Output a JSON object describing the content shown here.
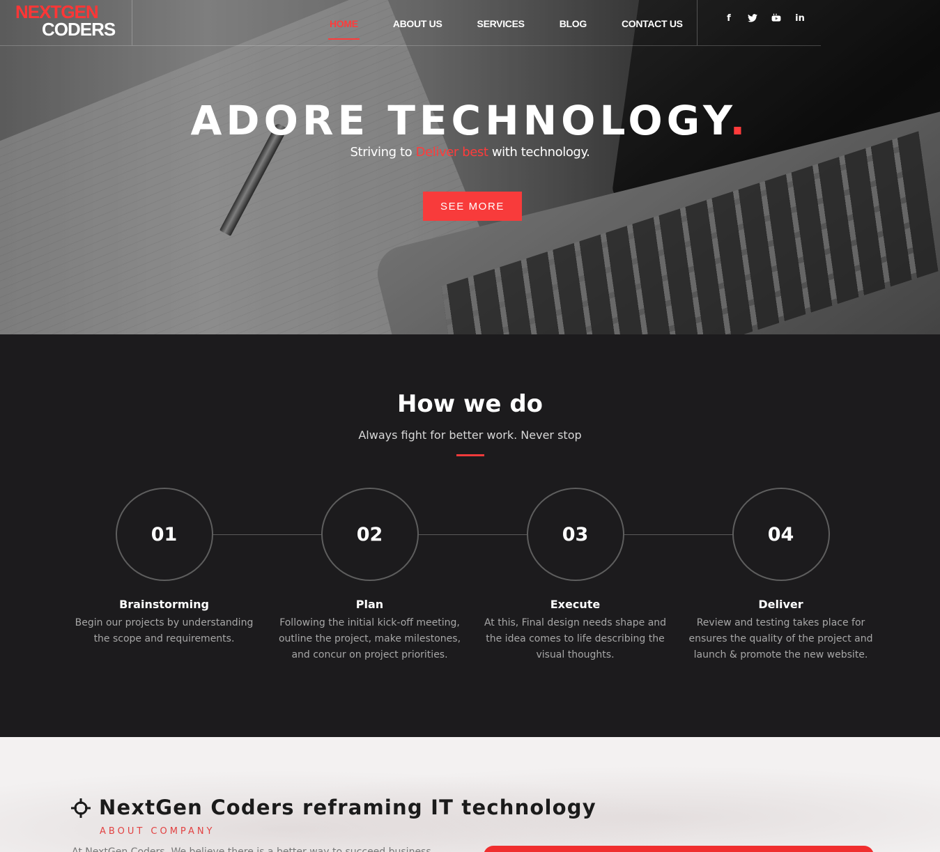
{
  "brand": {
    "line1": "NEXTGEN",
    "line2": "CODERS"
  },
  "nav": {
    "items": [
      {
        "label": "HOME",
        "active": true
      },
      {
        "label": "ABOUT US",
        "active": false
      },
      {
        "label": "SERVICES",
        "active": false
      },
      {
        "label": "BLOG",
        "active": false
      },
      {
        "label": "CONTACT US",
        "active": false
      }
    ],
    "social": [
      {
        "icon": "facebook-icon",
        "glyph": "f"
      },
      {
        "icon": "twitter-icon",
        "glyph": "🐦"
      },
      {
        "icon": "youtube-icon",
        "glyph": "▶"
      },
      {
        "icon": "linkedin-icon",
        "glyph": "in"
      }
    ]
  },
  "hero": {
    "title": "ADORE TECHNOLOGY",
    "title_dot": ".",
    "sub_prefix": "Striving to ",
    "sub_highlight": "Deliver best",
    "sub_suffix": " with technology.",
    "button": "SEE MORE"
  },
  "how": {
    "title": "How we do",
    "subtitle": "Always fight for better work. Never stop",
    "steps": [
      {
        "num": "01",
        "title": "Brainstorming",
        "text": "Begin our projects by understanding the scope and requirements."
      },
      {
        "num": "02",
        "title": "Plan",
        "text": "Following the initial kick-off meeting, outline the project, make milestones, and concur on project priorities."
      },
      {
        "num": "03",
        "title": "Execute",
        "text": "At this, Final design needs shape and the idea comes to life describing the visual thoughts."
      },
      {
        "num": "04",
        "title": "Deliver",
        "text": "Review and testing takes place for ensures the quality of the project and launch & promote the new website."
      }
    ]
  },
  "about": {
    "title": "NextGen Coders reframing IT technology",
    "kicker": "ABOUT COMPANY",
    "text": "At NextGen Coders, We believe there is a better way to succeed business"
  },
  "colors": {
    "accent": "#f83b3b",
    "dark": "#1c1b1d"
  }
}
